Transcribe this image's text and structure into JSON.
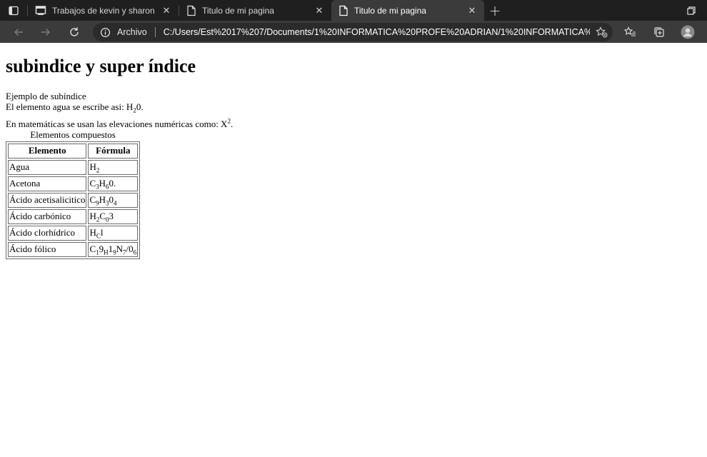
{
  "browser": {
    "tabs": [
      {
        "label": "Trabajos de kevin y sharon",
        "icon": "grid-icon",
        "active": false
      },
      {
        "label": "Titulo de mi pagina",
        "icon": "page-icon",
        "active": false
      },
      {
        "label": "Titulo de mi pagina",
        "icon": "page-icon",
        "active": true
      }
    ],
    "close_glyph": "✕",
    "new_tab_glyph": "+",
    "address": {
      "scheme_label": "Archivo",
      "url": "C:/Users/Est%2017%207/Documents/1%20INFORMATICA%20PROFE%20ADRIAN/1%20INFORMATICA%2..."
    },
    "theme": {
      "tabbar_bg": "#1f1f1f",
      "toolbar_bg": "#3b3b3b",
      "address_bg": "#2b2b2b"
    }
  },
  "page": {
    "title": "subindice y super índice",
    "sub_example_label": "Ejemplo de subíndice",
    "water": {
      "prefix": "El elemento agua se escribe asi: H",
      "sub": "2",
      "suffix": "0."
    },
    "math": {
      "prefix": "En matemáticas se usan las elevaciones numéricas como: X",
      "sup": "2",
      "suffix": "."
    },
    "table": {
      "caption": "Elementos compuestos",
      "headers": [
        "Elemento",
        "Fórmula"
      ],
      "rows": [
        {
          "element": "Agua",
          "formula": [
            {
              "t": "H"
            },
            {
              "sub": "2"
            }
          ]
        },
        {
          "element": "Acetona",
          "formula": [
            {
              "t": "C"
            },
            {
              "sub": "3"
            },
            {
              "t": "H"
            },
            {
              "sub": "6"
            },
            {
              "t": "0."
            }
          ]
        },
        {
          "element": "Ácido acetisalicitico",
          "formula": [
            {
              "t": "C"
            },
            {
              "sub": "9"
            },
            {
              "t": "H"
            },
            {
              "sub": "3"
            },
            {
              "t": "0"
            },
            {
              "sub": "4"
            }
          ]
        },
        {
          "element": "Ácido carbónico",
          "formula": [
            {
              "t": "H"
            },
            {
              "sub": "2"
            },
            {
              "t": "C"
            },
            {
              "sub": "0"
            },
            {
              "t": "3"
            }
          ]
        },
        {
          "element": "Ácido clorhídrico",
          "formula": [
            {
              "t": "H"
            },
            {
              "sub": "C"
            },
            {
              "t": "l"
            }
          ]
        },
        {
          "element": "Ácido fólico",
          "formula": [
            {
              "t": "C"
            },
            {
              "sub": "1"
            },
            {
              "t": "9"
            },
            {
              "sub": "H"
            },
            {
              "t": "1"
            },
            {
              "sub": "9"
            },
            {
              "t": "N"
            },
            {
              "sub": "7"
            },
            {
              "t": "/0"
            },
            {
              "sub": "6"
            }
          ]
        }
      ]
    }
  }
}
